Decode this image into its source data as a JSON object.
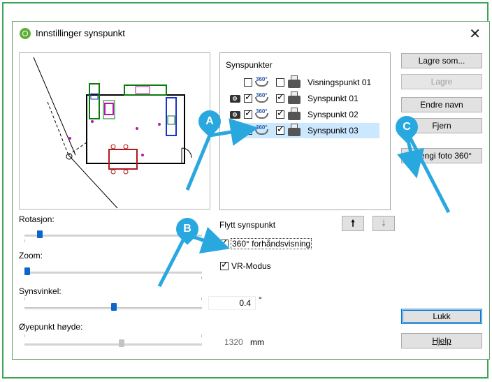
{
  "dialog": {
    "title": "Innstillinger synspunkt",
    "close_glyph": "✕"
  },
  "sliders": {
    "rotation": {
      "label": "Rotasjon:",
      "value_fraction": 0.08
    },
    "zoom": {
      "label": "Zoom:",
      "value_fraction": 0.01
    },
    "fov": {
      "label": "Synsvinkel:",
      "value": "0.4",
      "unit": "°",
      "value_fraction": 0.5
    },
    "eye_height": {
      "label": "Øyepunkt høyde:",
      "value": "1320",
      "unit": "mm",
      "value_fraction": 0.5
    }
  },
  "viewpoints": {
    "header": "Synspunkter",
    "items": [
      {
        "label": "Visningspunkt 01",
        "camera": false,
        "vr_checked": false,
        "print_checked": false,
        "selected": false
      },
      {
        "label": "Synspunkt 01",
        "camera": true,
        "vr_checked": true,
        "print_checked": true,
        "selected": false
      },
      {
        "label": "Synspunkt 02",
        "camera": true,
        "vr_checked": true,
        "print_checked": true,
        "selected": false
      },
      {
        "label": "Synspunkt 03",
        "camera": false,
        "vr_checked": true,
        "print_checked": true,
        "selected": true
      }
    ],
    "icon_360": "360°"
  },
  "move": {
    "label": "Flytt synspunkt",
    "up_glyph": "🠕",
    "down_glyph": "🠗"
  },
  "options": {
    "preview360": {
      "label": "360° forhåndsvisning",
      "checked": true
    },
    "vr_mode": {
      "label": "VR-Modus",
      "checked": true
    }
  },
  "buttons": {
    "save_as": "Lagre som...",
    "save": "Lagre",
    "rename": "Endre navn",
    "remove": "Fjern",
    "render360": "Gjengi foto 360°",
    "close": "Lukk",
    "help": "Hjelp"
  },
  "callouts": {
    "a": "A",
    "b": "B",
    "c": "C",
    "color": "#29a8e0"
  }
}
